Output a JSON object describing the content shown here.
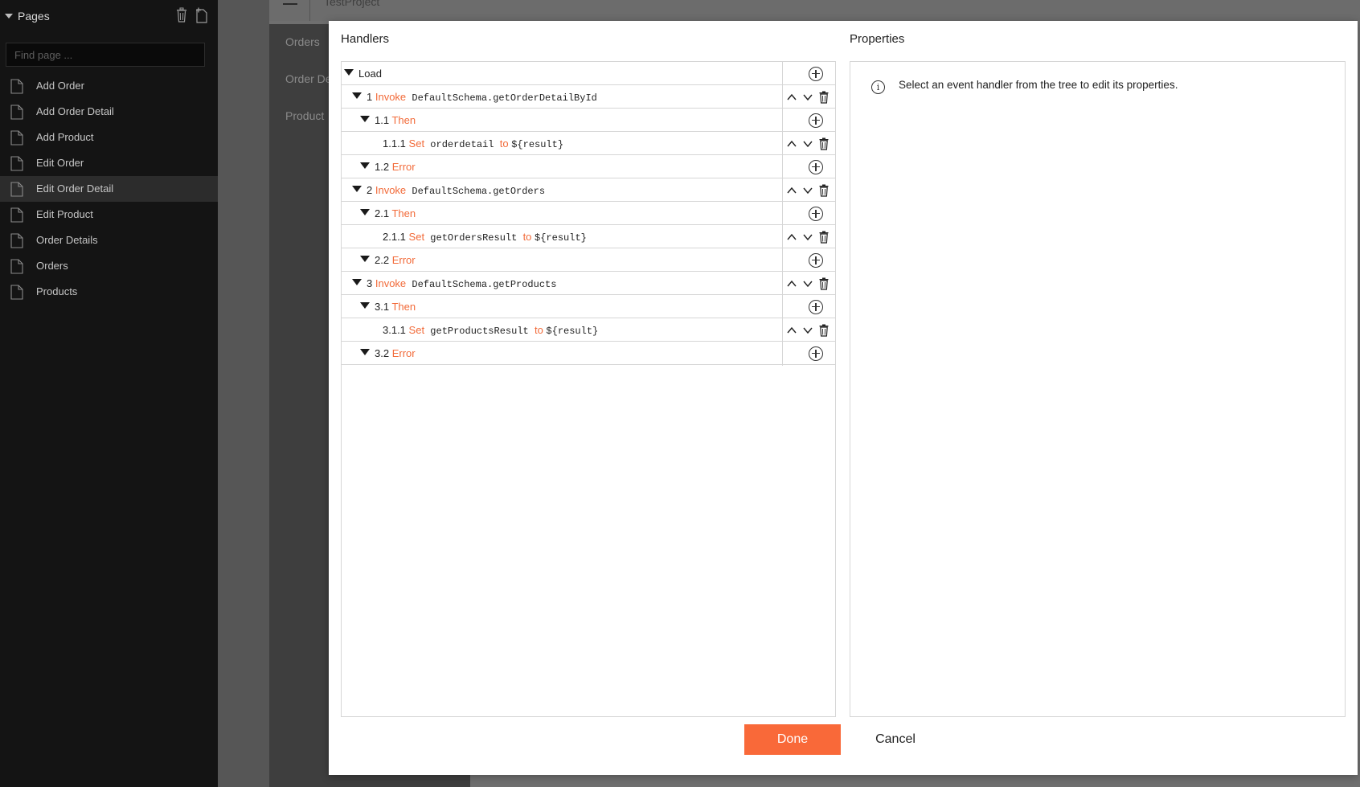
{
  "sidebar": {
    "title": "Pages",
    "delete_icon": "trash-icon",
    "add_icon": "new-page-icon",
    "search_placeholder": "Find page ...",
    "items": [
      {
        "label": "Add Order",
        "active": false
      },
      {
        "label": "Add Order Detail",
        "active": false
      },
      {
        "label": "Add Product",
        "active": false
      },
      {
        "label": "Edit Order",
        "active": false
      },
      {
        "label": "Edit Order Detail",
        "active": true
      },
      {
        "label": "Edit Product",
        "active": false
      },
      {
        "label": "Order Details",
        "active": false
      },
      {
        "label": "Orders",
        "active": false
      },
      {
        "label": "Products",
        "active": false
      }
    ]
  },
  "background": {
    "project_name": "TestProject",
    "left_items": [
      "Orders",
      "Order De",
      "Product"
    ]
  },
  "dialog": {
    "handlers_title": "Handlers",
    "properties_title": "Properties",
    "properties_message": "Select an event handler from the tree to edit its properties.",
    "done_label": "Done",
    "cancel_label": "Cancel",
    "tree": [
      {
        "num": "",
        "keyword": "",
        "text": "Load",
        "level": 0,
        "expandable": true,
        "actions": "add"
      },
      {
        "num": "1",
        "keyword": "Invoke",
        "code": "DefaultSchema.getOrderDetailById",
        "level": 1,
        "expandable": true,
        "actions": "move"
      },
      {
        "num": "1.1",
        "keyword": "Then",
        "level": 2,
        "expandable": true,
        "actions": "add"
      },
      {
        "num": "1.1.1",
        "keyword": "Set",
        "code": "orderdetail",
        "to": "to",
        "value": "${result}",
        "level": 3,
        "expandable": false,
        "actions": "move"
      },
      {
        "num": "1.2",
        "keyword": "Error",
        "level": 2,
        "expandable": true,
        "actions": "add"
      },
      {
        "num": "2",
        "keyword": "Invoke",
        "code": "DefaultSchema.getOrders",
        "level": 1,
        "expandable": true,
        "actions": "move"
      },
      {
        "num": "2.1",
        "keyword": "Then",
        "level": 2,
        "expandable": true,
        "actions": "add"
      },
      {
        "num": "2.1.1",
        "keyword": "Set",
        "code": "getOrdersResult",
        "to": "to",
        "value": "${result}",
        "level": 3,
        "expandable": false,
        "actions": "move"
      },
      {
        "num": "2.2",
        "keyword": "Error",
        "level": 2,
        "expandable": true,
        "actions": "add"
      },
      {
        "num": "3",
        "keyword": "Invoke",
        "code": "DefaultSchema.getProducts",
        "level": 1,
        "expandable": true,
        "actions": "move"
      },
      {
        "num": "3.1",
        "keyword": "Then",
        "level": 2,
        "expandable": true,
        "actions": "add"
      },
      {
        "num": "3.1.1",
        "keyword": "Set",
        "code": "getProductsResult",
        "to": "to",
        "value": "${result}",
        "level": 3,
        "expandable": false,
        "actions": "move"
      },
      {
        "num": "3.2",
        "keyword": "Error",
        "level": 2,
        "expandable": true,
        "actions": "add"
      }
    ]
  },
  "colors": {
    "accent": "#f96939",
    "keyword": "#f26b3a",
    "sidebar_bg": "#141414"
  }
}
